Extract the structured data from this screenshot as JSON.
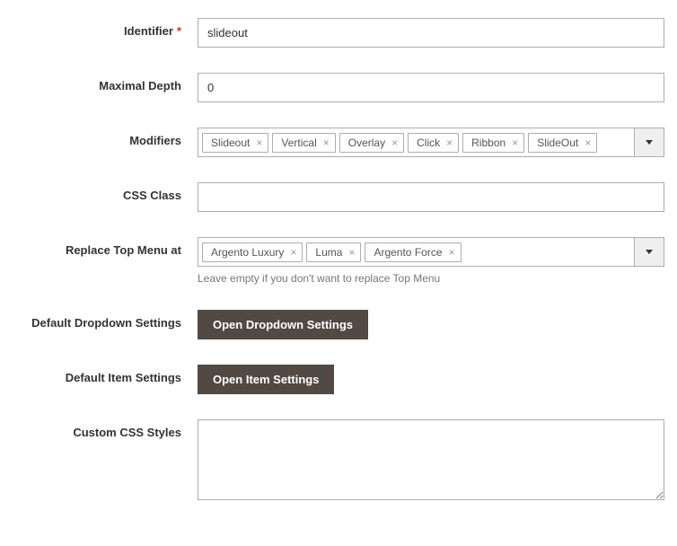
{
  "fields": {
    "identifier": {
      "label": "Identifier",
      "value": "slideout",
      "required": true
    },
    "maximal_depth": {
      "label": "Maximal Depth",
      "value": "0"
    },
    "modifiers": {
      "label": "Modifiers",
      "tags": [
        "Slideout",
        "Vertical",
        "Overlay",
        "Click",
        "Ribbon",
        "SlideOut"
      ]
    },
    "css_class": {
      "label": "CSS Class",
      "value": ""
    },
    "replace_top_menu": {
      "label": "Replace Top Menu at",
      "tags": [
        "Argento Luxury",
        "Luma",
        "Argento Force"
      ],
      "hint": "Leave empty if you don't want to replace Top Menu"
    },
    "default_dropdown": {
      "label": "Default Dropdown Settings",
      "button": "Open Dropdown Settings"
    },
    "default_item": {
      "label": "Default Item Settings",
      "button": "Open Item Settings"
    },
    "custom_css": {
      "label": "Custom CSS Styles",
      "value": ""
    }
  }
}
